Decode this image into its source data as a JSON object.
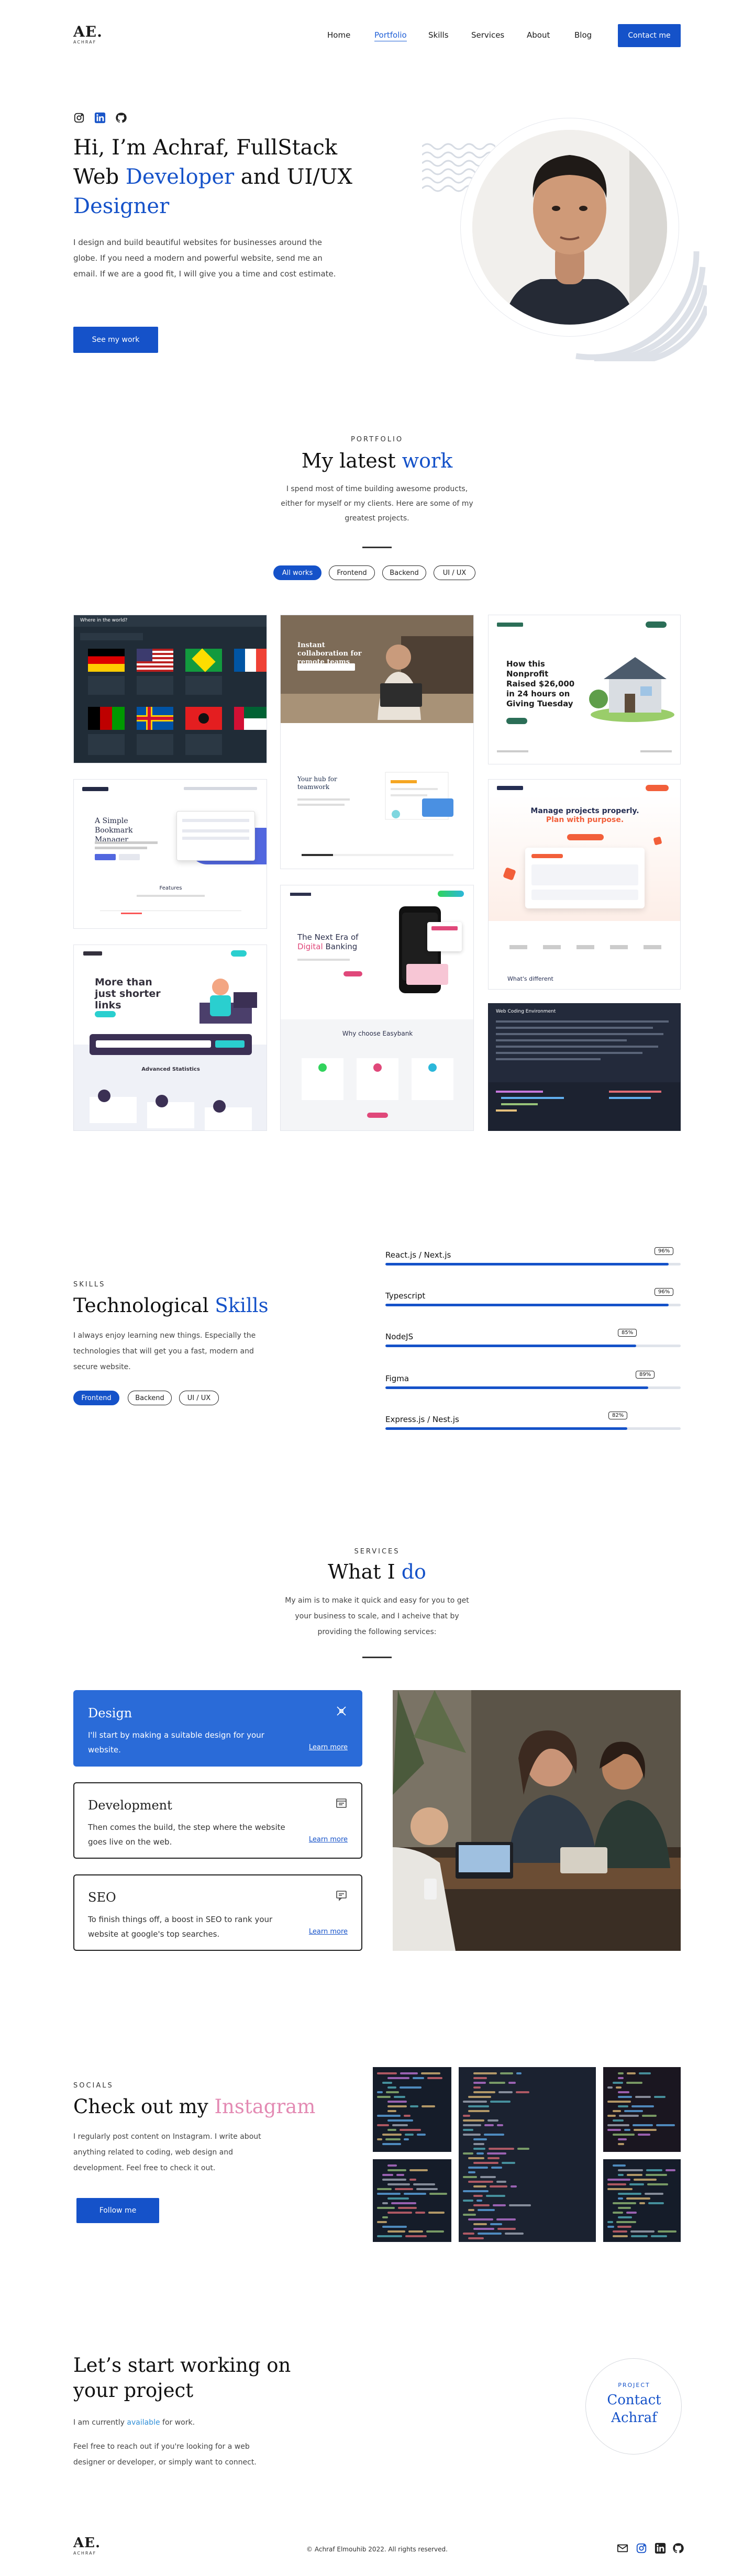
{
  "brand": {
    "logo": "AE.",
    "logo_sub": "ACHRAF"
  },
  "nav": {
    "items": [
      "Home",
      "Portfolio",
      "Skills",
      "Services",
      "About",
      "Blog"
    ],
    "cta": "Contact me"
  },
  "hero": {
    "social_icons": [
      "instagram-icon",
      "linkedin-icon",
      "github-icon"
    ],
    "title_line1": "Hi, I’m Achraf, FullStack",
    "title_web": "Web ",
    "title_developer": "Developer",
    "title_and": " and UI/UX",
    "title_designer": "Designer",
    "description": "I design and build beautiful websites for businesses around the globe. If you need a modern and powerful website, send me an email. If we are a good fit, I will give you a time and cost estimate.",
    "button": "See my work"
  },
  "portfolio": {
    "kicker": "PORTFOLIO",
    "title_a": "My latest ",
    "title_b": "work",
    "description": "I spend most of time building awesome products, either for myself or my clients. Here are some of my greatest projects.",
    "filters": [
      "All works",
      "Frontend",
      "Backend",
      "UI / UX"
    ],
    "projects": {
      "flags_title": "Where in the world?",
      "remote_title": "Instant collaboration for remote teams",
      "remote_sub": "Your hub for teamwork",
      "nonprofit_title": "How this Nonprofit Raised $26,000 in 24 hours on Giving Tuesday",
      "bookmark_title": "A Simple Bookmark Manager",
      "bookmark_features": "Features",
      "manage_title_a": "Manage projects properly.",
      "manage_title_b": "Plan with purpose.",
      "manage_diff": "What's different",
      "banking_title_a": "The Next Era of",
      "banking_title_b": "Digital",
      "banking_title_c": "Banking",
      "banking_why": "Why choose Easybank",
      "shortly_title": "More than just shorter links",
      "shortly_stats": "Advanced Statistics",
      "code_title": "Web Coding Environment"
    }
  },
  "skills": {
    "kicker": "SKILLS",
    "title_a": "Technological ",
    "title_b": "Skills",
    "description": "I always enjoy learning new things. Especially the technologies that will get you a fast, modern and secure website.",
    "filters": [
      "Frontend",
      "Backend",
      "UI / UX"
    ],
    "items": [
      {
        "name": "React.js / Next.js",
        "percent": 96,
        "label": "96%"
      },
      {
        "name": "Typescript",
        "percent": 96,
        "label": "96%"
      },
      {
        "name": "NodeJS",
        "percent": 85,
        "label": "85%"
      },
      {
        "name": "Figma",
        "percent": 89,
        "label": "89%"
      },
      {
        "name": "Express.js / Nest.js",
        "percent": 82,
        "label": "82%"
      }
    ]
  },
  "services": {
    "kicker": "SERVICES",
    "title_a": "What I ",
    "title_b": "do",
    "description": "My aim is to make it quick and easy for you to get your business to scale, and I acheive that by providing the following services:",
    "items": [
      {
        "title": "Design",
        "text": "I'll start by making a suitable design for your website.",
        "link": "Learn more",
        "icon": "design-icon"
      },
      {
        "title": "Development",
        "text": "Then comes the build, the step where the website goes live on the web.",
        "link": "Learn more",
        "icon": "browser-icon"
      },
      {
        "title": "SEO",
        "text": "To finish things off, a boost in SEO to rank your website at google's top searches.",
        "link": "Learn more",
        "icon": "chat-icon"
      }
    ]
  },
  "socials": {
    "kicker": "SOCIALS",
    "title_a": "Check out my ",
    "title_b": "Instagram",
    "description": "I regularly post content on Instagram. I write about anything related to coding, web design and development. Feel free to check it out.",
    "button": "Follow me"
  },
  "contact": {
    "title_line1": "Let’s start working on",
    "title_line2": "your project",
    "status_a": "I am currently ",
    "status_b": "available",
    "status_c": " for work.",
    "description": "Feel free to reach out if you're looking for a web designer or developer, or simply want to connect.",
    "circle_kicker": "PROJECT",
    "circle_title_a": "Contact",
    "circle_title_b": "Achraf"
  },
  "footer": {
    "copyright": "© Achraf Elmouhib 2022. All rights reserved.",
    "icons": [
      "mail-icon",
      "instagram-icon",
      "linkedin-icon",
      "github-icon"
    ]
  },
  "colors": {
    "accent": "#1552c9",
    "pink": "#e38ab3",
    "available": "#2f8fd8"
  }
}
